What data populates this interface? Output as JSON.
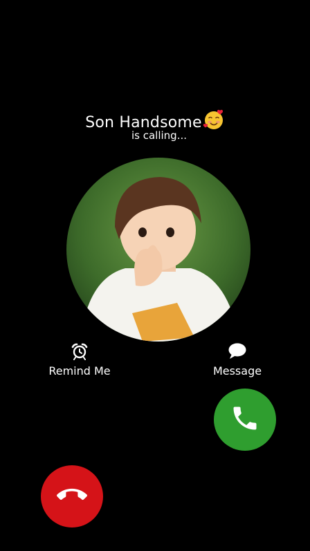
{
  "caller": {
    "name": "Son Handsome",
    "emoji": "🥰",
    "status": "is calling..."
  },
  "actions": {
    "remind_label": "Remind Me",
    "message_label": "Message"
  },
  "colors": {
    "background": "#000000",
    "accept": "#2f9e2f",
    "decline": "#d51318"
  },
  "icons": {
    "remind": "alarm-clock-icon",
    "message": "chat-bubble-icon",
    "accept": "phone-icon",
    "decline": "phone-hangup-icon"
  }
}
